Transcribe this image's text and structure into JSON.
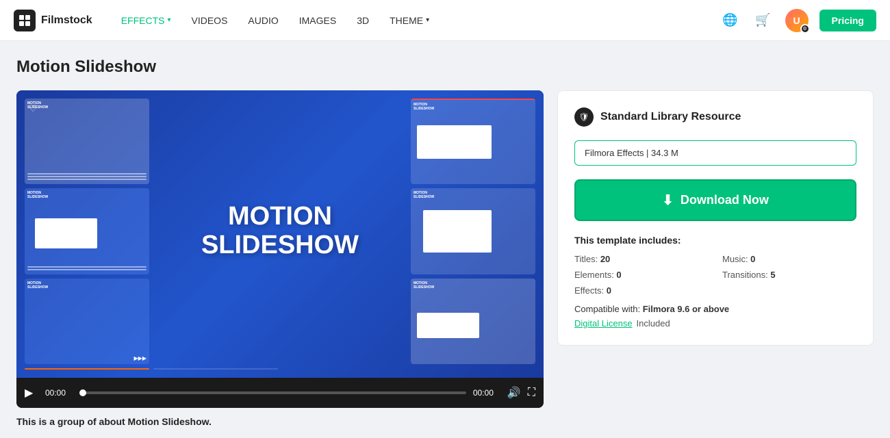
{
  "header": {
    "logo_text": "Filmstock",
    "nav_items": [
      {
        "label": "EFFECTS",
        "has_chevron": true,
        "active": true
      },
      {
        "label": "VIDEOS",
        "has_chevron": false,
        "active": false
      },
      {
        "label": "AUDIO",
        "has_chevron": false,
        "active": false
      },
      {
        "label": "IMAGES",
        "has_chevron": false,
        "active": false
      },
      {
        "label": "3D",
        "has_chevron": false,
        "active": false
      },
      {
        "label": "THEME",
        "has_chevron": true,
        "active": false
      }
    ],
    "pricing_label": "Pricing"
  },
  "page": {
    "title": "Motion Slideshow"
  },
  "video": {
    "center_text_line1": "MOTION",
    "center_text_line2": "SLIDESHOW",
    "time_start": "00:00",
    "time_end": "00:00"
  },
  "sidebar": {
    "resource_title": "Standard Library Resource",
    "file_info": "Filmora Effects | 34.3 M",
    "download_label": "Download Now",
    "template_includes_label": "This template includes:",
    "stats": [
      {
        "label": "Titles:",
        "value": "20"
      },
      {
        "label": "Music:",
        "value": "0"
      },
      {
        "label": "Elements:",
        "value": "0"
      },
      {
        "label": "Transitions:",
        "value": "5"
      },
      {
        "label": "Effects:",
        "value": "0"
      }
    ],
    "compatible_label": "Compatible with:",
    "compatible_value": "Filmora 9.6 or above",
    "license_link_text": "Digital License",
    "license_included": "Included"
  },
  "description": {
    "text": "This is a group of about Motion Slideshow."
  }
}
